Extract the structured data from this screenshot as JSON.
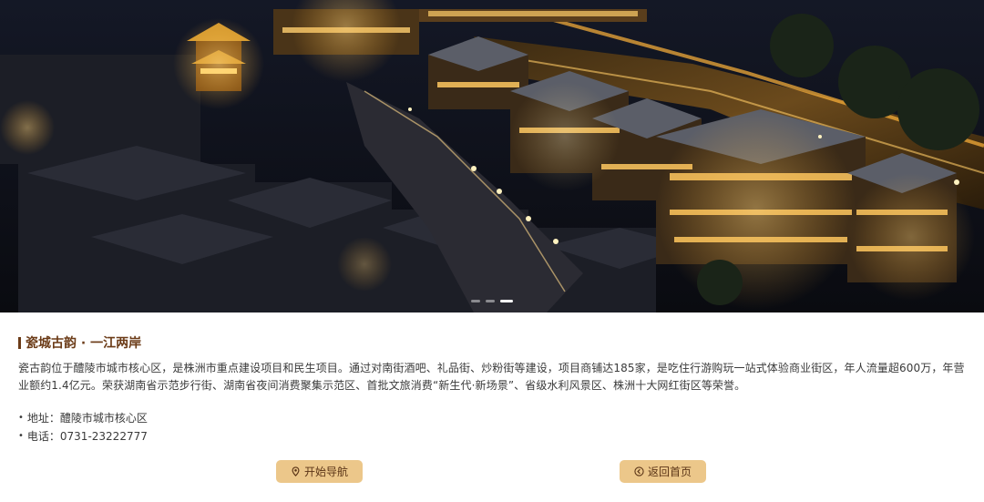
{
  "hero": {
    "image_alt": "night view of the ancient porcelain town along the river",
    "slides": 3,
    "active_slide": 3
  },
  "section": {
    "title": "瓷城古韵 · 一江两岸",
    "description": "瓷古韵位于醴陵市城市核心区，是株洲市重点建设项目和民生项目。通过对南街酒吧、礼品街、炒粉街等建设，项目商铺达185家，是吃住行游购玩一站式体验商业街区，年人流量超600万，年营业额约1.4亿元。荣获湖南省示范步行街、湖南省夜间消费聚集示范区、首批文旅消费“新生代·新场景”、省级水利风景区、株洲十大网红街区等荣誉。",
    "address": "地址：醴陵市城市核心区",
    "phone": "电话：0731-23222777"
  },
  "buttons": {
    "navigate_label": "开始导航",
    "home_label": "返回首页"
  },
  "colors": {
    "title": "#6b3b17",
    "button_bg": "#ecc78a",
    "button_text": "#5b3517"
  },
  "icons": {
    "navigate": "location-pin-icon",
    "home": "back-circle-icon"
  }
}
